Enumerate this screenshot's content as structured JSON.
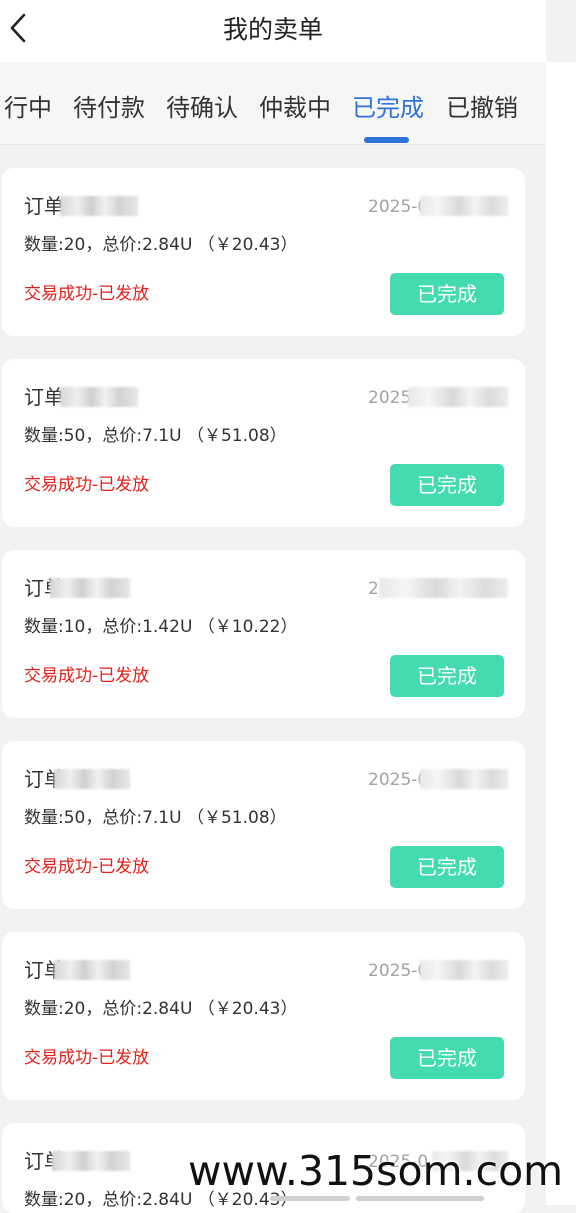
{
  "header": {
    "title": "我的卖单",
    "back_icon": "chevron-left-icon"
  },
  "tabs": [
    {
      "label": "行中",
      "active": false
    },
    {
      "label": "待付款",
      "active": false
    },
    {
      "label": "待确认",
      "active": false
    },
    {
      "label": "仲裁中",
      "active": false
    },
    {
      "label": "已完成",
      "active": true
    },
    {
      "label": "已撤销",
      "active": false
    }
  ],
  "colors": {
    "accent": "#2f73d8",
    "status_red": "#e2211c",
    "button_green": "#45dbb0",
    "time_gray": "#a2a2a2"
  },
  "orders": [
    {
      "order_label": "订单",
      "time": "2025-05",
      "detail": "数量:20，总价:2.84U （￥20.43）",
      "status": "交易成功-已发放",
      "button": "已完成"
    },
    {
      "order_label": "订单",
      "time": "2025",
      "detail": "数量:50，总价:7.1U （￥51.08）",
      "status": "交易成功-已发放",
      "button": "已完成"
    },
    {
      "order_label": "订单",
      "time": "2",
      "detail": "数量:10，总价:1.42U （￥10.22）",
      "status": "交易成功-已发放",
      "button": "已完成"
    },
    {
      "order_label": "订单",
      "time": "2025-05",
      "detail": "数量:50，总价:7.1U （￥51.08）",
      "status": "交易成功-已发放",
      "button": "已完成"
    },
    {
      "order_label": "订单",
      "time": "2025-05",
      "detail": "数量:20，总价:2.84U （￥20.43）",
      "status": "交易成功-已发放",
      "button": "已完成"
    },
    {
      "order_label": "订单",
      "time": "2025-0",
      "detail": "数量:20，总价:2.84U （￥20.43）",
      "status": "",
      "button": ""
    }
  ],
  "watermark": "www.315som.com"
}
